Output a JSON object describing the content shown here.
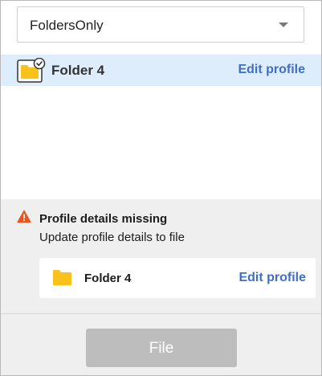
{
  "profile_dropdown": {
    "selected_value": "FoldersOnly"
  },
  "selected_folder": {
    "name": "Folder 4",
    "edit_label": "Edit profile",
    "icon": "folder-check-icon"
  },
  "warning": {
    "icon": "warning-icon",
    "title": "Profile details missing",
    "message": "Update profile details to file",
    "items": [
      {
        "name": "Folder 4",
        "edit_label": "Edit profile",
        "icon": "folder-icon"
      }
    ]
  },
  "footer": {
    "file_button_label": "File",
    "file_button_enabled": false
  },
  "colors": {
    "folder": "#F9C21A",
    "link": "#3F6FC4",
    "selected_row_bg": "#DEEDFB",
    "warning_icon": "#E5571C",
    "disabled_button": "#BDBDBD"
  }
}
